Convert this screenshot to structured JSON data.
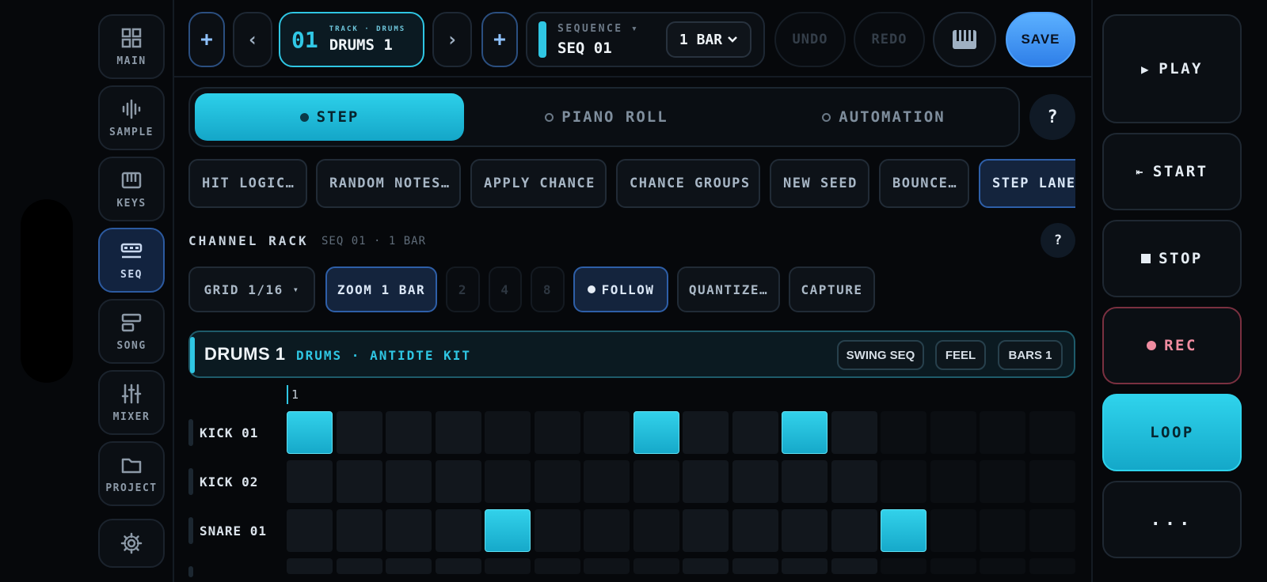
{
  "nav": [
    {
      "label": "MAIN",
      "icon": "grid-icon"
    },
    {
      "label": "SAMPLE",
      "icon": "waveform-icon"
    },
    {
      "label": "KEYS",
      "icon": "keyboard-icon"
    },
    {
      "label": "SEQ",
      "icon": "sequencer-icon",
      "active": true
    },
    {
      "label": "SONG",
      "icon": "song-icon"
    },
    {
      "label": "MIXER",
      "icon": "mixer-icon"
    },
    {
      "label": "PROJECT",
      "icon": "folder-icon"
    }
  ],
  "topbar": {
    "add": "+",
    "prev": "‹",
    "next": "›",
    "track_number": "01",
    "track_caption": "TRACK · DRUMS",
    "track_name": "DRUMS 1",
    "sequence_caption": "SEQUENCE ▾",
    "sequence_name": "SEQ 01",
    "bar_length": "1 BAR",
    "undo": "UNDO",
    "redo": "REDO",
    "save": "SAVE"
  },
  "modes": {
    "step": "STEP",
    "piano_roll": "PIANO ROLL",
    "automation": "AUTOMATION",
    "help": "?"
  },
  "actions": [
    "HIT LOGIC…",
    "RANDOM NOTES…",
    "APPLY CHANCE",
    "CHANCE GROUPS",
    "NEW SEED",
    "BOUNCE…",
    "STEP LANE"
  ],
  "rack": {
    "title": "CHANNEL RACK",
    "subtitle": "SEQ 01 · 1 BAR",
    "help": "?"
  },
  "controls": {
    "grid": "GRID 1/16",
    "grid_caret": "▾",
    "zoom": "ZOOM 1 BAR",
    "zoom_2": "2",
    "zoom_4": "4",
    "zoom_8": "8",
    "follow": "FOLLOW",
    "quantize": "QUANTIZE…",
    "capture": "CAPTURE"
  },
  "track_header": {
    "name": "DRUMS 1",
    "subtitle": "DRUMS · ANTIDTE KIT",
    "swing": "SWING SEQ",
    "feel": "FEEL",
    "bars": "BARS 1"
  },
  "ruler_start": "1",
  "rows": [
    {
      "label": "KICK 01",
      "steps": [
        1,
        0,
        0,
        0,
        0,
        0,
        0,
        1,
        0,
        0,
        1,
        0,
        0,
        0,
        0,
        0
      ]
    },
    {
      "label": "KICK 02",
      "steps": [
        0,
        0,
        0,
        0,
        0,
        0,
        0,
        0,
        0,
        0,
        0,
        0,
        0,
        0,
        0,
        0
      ]
    },
    {
      "label": "SNARE 01",
      "steps": [
        0,
        0,
        0,
        0,
        1,
        0,
        0,
        0,
        0,
        0,
        0,
        0,
        1,
        0,
        0,
        0
      ]
    }
  ],
  "transport": {
    "play": "PLAY",
    "start": "START",
    "stop": "STOP",
    "rec": "REC",
    "loop": "LOOP",
    "more": "..."
  },
  "colors": {
    "accent": "#2fc6e3",
    "save": "#4ea2ff",
    "rec": "#ef8ca0"
  }
}
